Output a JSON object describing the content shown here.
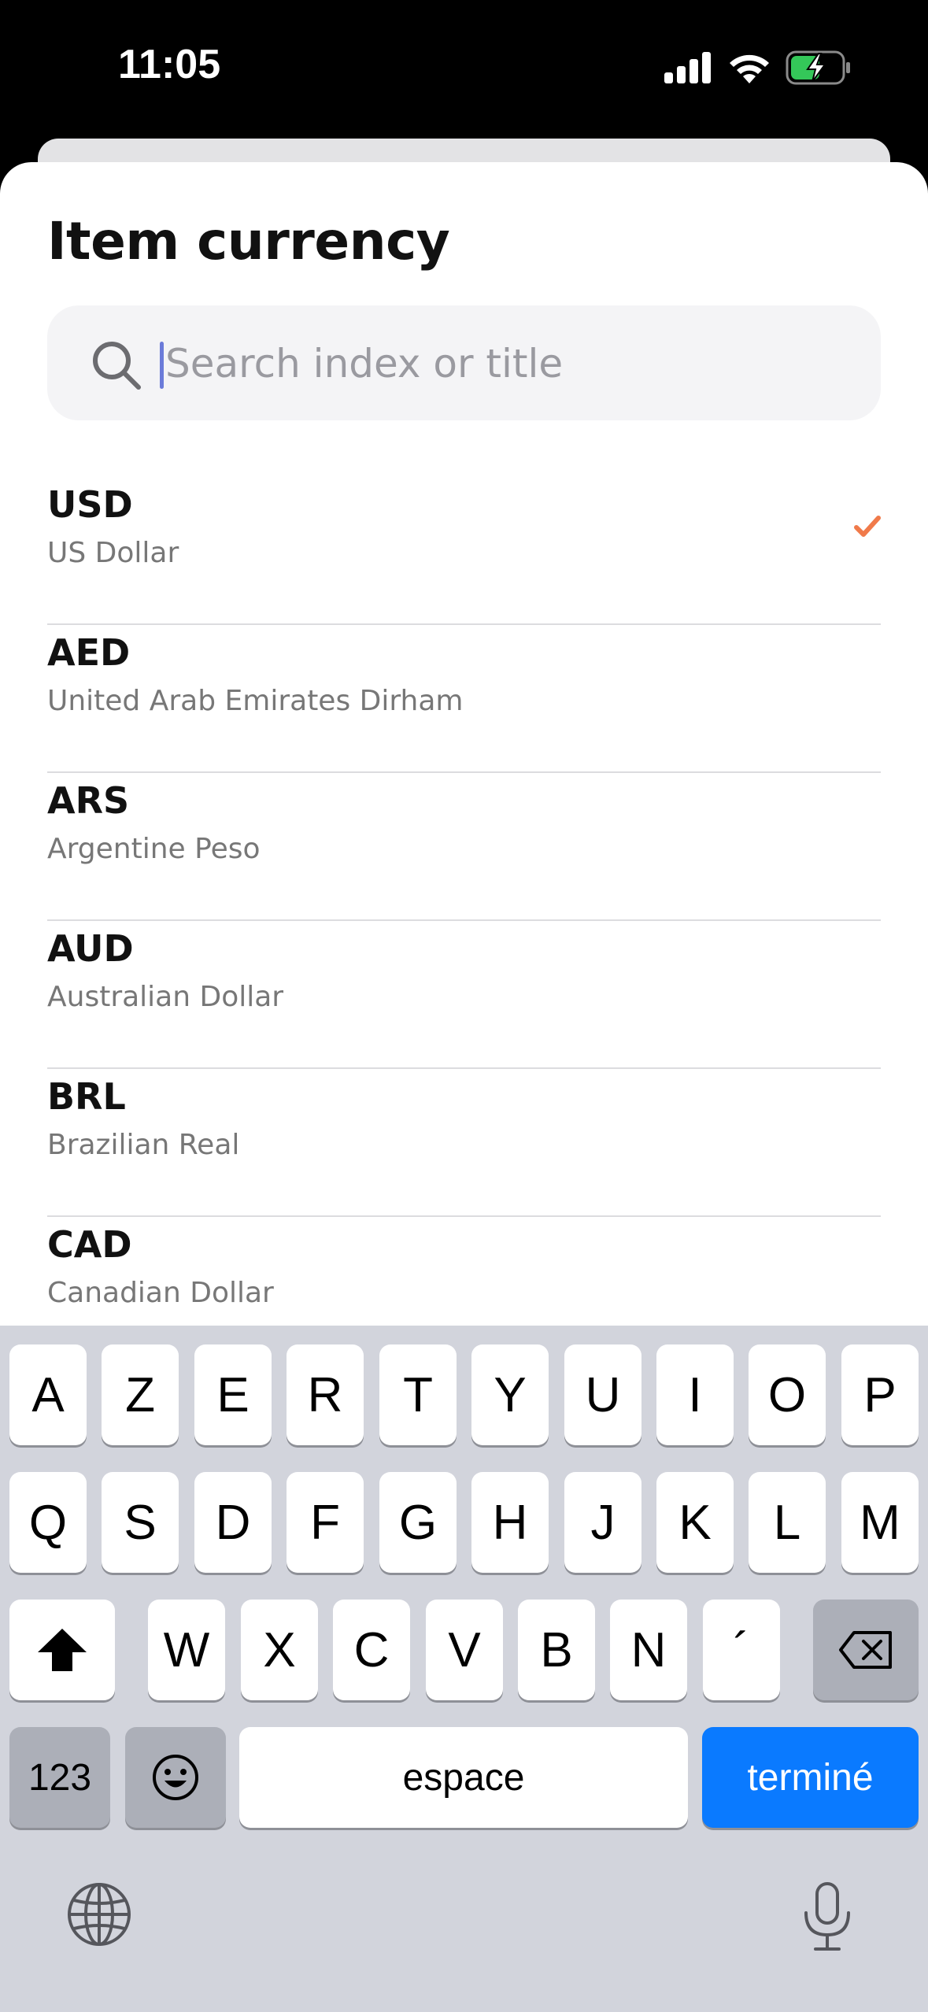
{
  "status_bar": {
    "time": "11:05"
  },
  "sheet": {
    "title": "Item currency",
    "search": {
      "placeholder": "Search index or title",
      "value": ""
    }
  },
  "currencies": [
    {
      "code": "USD",
      "name": "US Dollar",
      "selected": true
    },
    {
      "code": "AED",
      "name": "United Arab Emirates Dirham",
      "selected": false
    },
    {
      "code": "ARS",
      "name": "Argentine Peso",
      "selected": false
    },
    {
      "code": "AUD",
      "name": "Australian Dollar",
      "selected": false
    },
    {
      "code": "BRL",
      "name": "Brazilian Real",
      "selected": false
    },
    {
      "code": "CAD",
      "name": "Canadian Dollar",
      "selected": false
    }
  ],
  "keyboard": {
    "row1": [
      "A",
      "Z",
      "E",
      "R",
      "T",
      "Y",
      "U",
      "I",
      "O",
      "P"
    ],
    "row2": [
      "Q",
      "S",
      "D",
      "F",
      "G",
      "H",
      "J",
      "K",
      "L",
      "M"
    ],
    "row3": [
      "W",
      "X",
      "C",
      "V",
      "B",
      "N",
      "´"
    ],
    "numbers_label": "123",
    "space_label": "espace",
    "done_label": "terminé"
  },
  "colors": {
    "accent_check": "#f07a4a",
    "done_key": "#0a7aff",
    "caret": "#6b7bd9"
  }
}
